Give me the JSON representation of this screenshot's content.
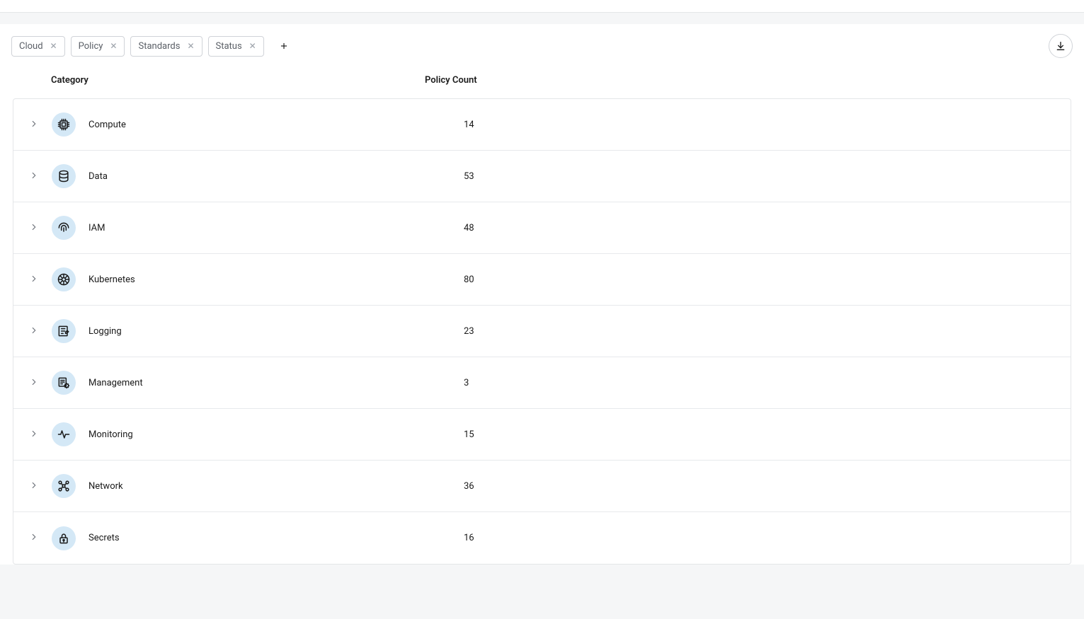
{
  "filters": [
    {
      "label": "Cloud"
    },
    {
      "label": "Policy"
    },
    {
      "label": "Standards"
    },
    {
      "label": "Status"
    }
  ],
  "columns": {
    "category": "Category",
    "policy_count": "Policy Count"
  },
  "rows": [
    {
      "icon": "compute",
      "name": "Compute",
      "count": "14"
    },
    {
      "icon": "data",
      "name": "Data",
      "count": "53"
    },
    {
      "icon": "iam",
      "name": "IAM",
      "count": "48"
    },
    {
      "icon": "kubernetes",
      "name": "Kubernetes",
      "count": "80"
    },
    {
      "icon": "logging",
      "name": "Logging",
      "count": "23"
    },
    {
      "icon": "management",
      "name": "Management",
      "count": "3"
    },
    {
      "icon": "monitoring",
      "name": "Monitoring",
      "count": "15"
    },
    {
      "icon": "network",
      "name": "Network",
      "count": "36"
    },
    {
      "icon": "secrets",
      "name": "Secrets",
      "count": "16"
    }
  ],
  "colors": {
    "icon_badge_bg": "#d4e8f6",
    "icon_stroke": "#1a1a1a"
  }
}
